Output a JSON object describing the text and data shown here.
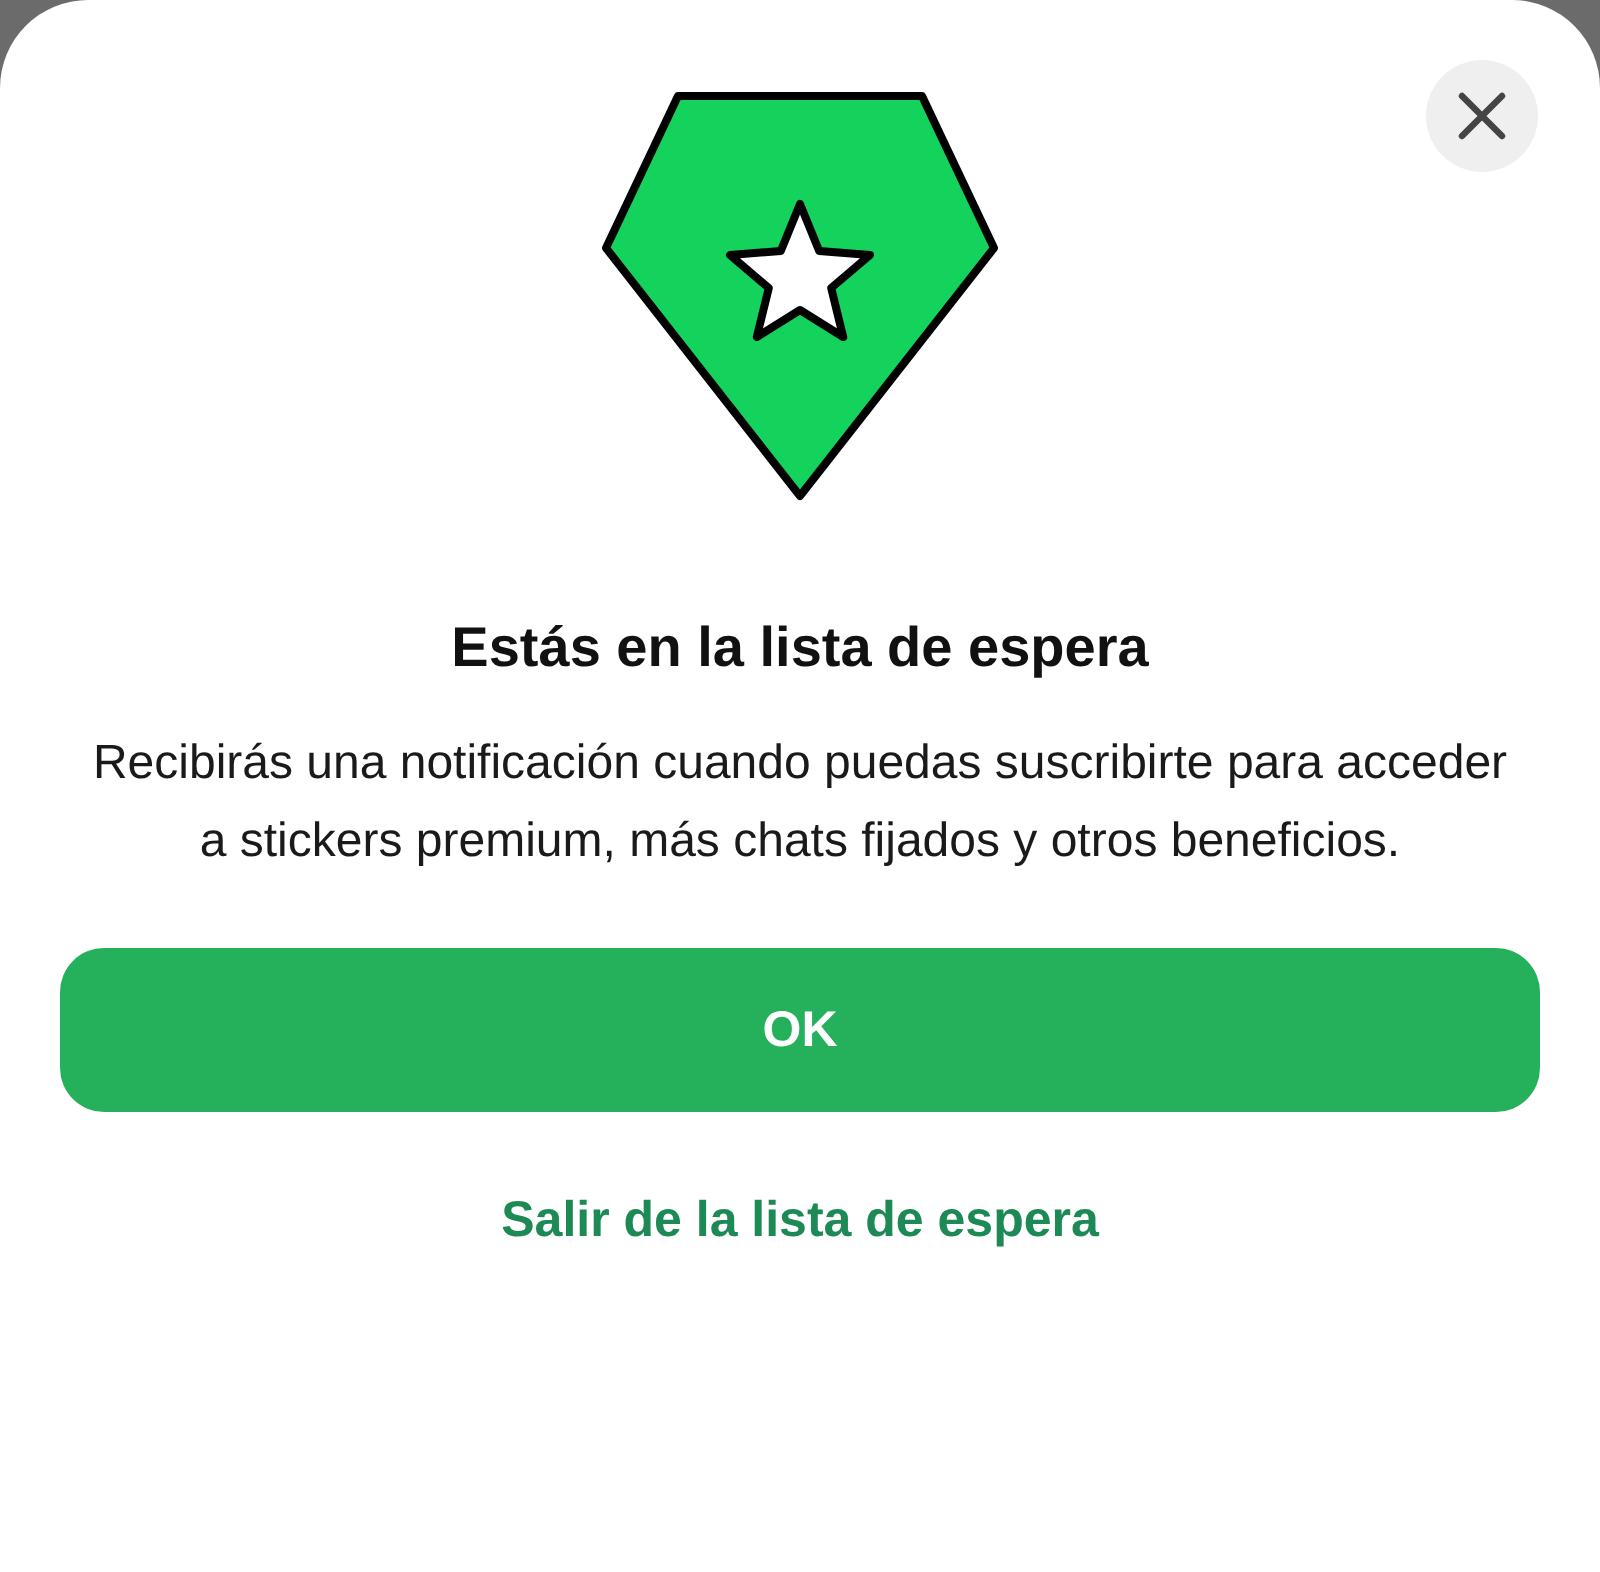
{
  "sheet": {
    "title": "Estás en la lista de espera",
    "message": "Recibirás una notificación cuando puedas suscribirte para acceder a stickers premium, más chats fijados y otros beneficios.",
    "primary_button": "OK",
    "secondary_link": "Salir de la lista de espera"
  }
}
